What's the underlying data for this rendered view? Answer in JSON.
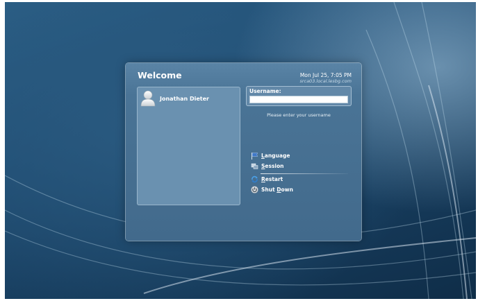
{
  "login": {
    "title": "Welcome",
    "datetime": "Mon Jul 25,  7:05 PM",
    "hostname": "srca03.local.lesbg.com",
    "users": [
      {
        "name": "Jonathan Dieter",
        "icon": "user-avatar-icon"
      }
    ],
    "username_label": "Username:",
    "username_value": "",
    "prompt": "Please enter your username",
    "actions": {
      "language": {
        "pre": "",
        "key": "L",
        "rest": "anguage",
        "icon": "flag-icon"
      },
      "session": {
        "pre": "",
        "key": "S",
        "rest": "ession",
        "icon": "windows-icon"
      },
      "restart": {
        "pre": "",
        "key": "R",
        "rest": "estart",
        "icon": "restart-icon"
      },
      "shutdown": {
        "pre": "Shut ",
        "key": "D",
        "rest": "own",
        "icon": "power-icon"
      }
    }
  },
  "colors": {
    "background": "#1f4c72",
    "dialog": "#4a7496",
    "panel": "#6a91b0",
    "text": "#ffffff"
  }
}
